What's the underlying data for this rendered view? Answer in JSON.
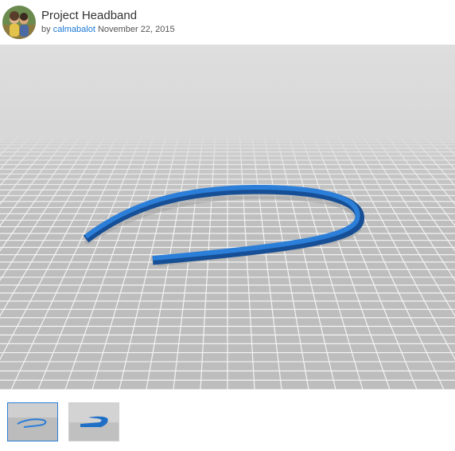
{
  "header": {
    "title": "Project Headband",
    "by_label": "by",
    "author": "calmabalot",
    "date": "November 22, 2015"
  },
  "viewer": {
    "object_color": "#1f6fc7",
    "background_color": "#d9d9d9"
  },
  "thumbnails": [
    {
      "name": "thumbnail-1",
      "selected": true
    },
    {
      "name": "thumbnail-2",
      "selected": false
    }
  ]
}
